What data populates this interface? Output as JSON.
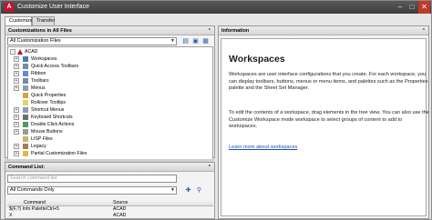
{
  "window": {
    "title": "Customize User Interface",
    "icon": "autocad-icon"
  },
  "tabs": [
    {
      "label": "Customize"
    },
    {
      "label": "Transfer"
    }
  ],
  "customizations": {
    "header": "Customizations in All Files",
    "filter": "All Customization Files",
    "tree": [
      {
        "label": "ACAD",
        "icon": "acad-icon",
        "expander": "-"
      },
      {
        "label": "Workspaces",
        "icon": "workspace-icon",
        "expander": "+"
      },
      {
        "label": "Quick Access Toolbars",
        "icon": "toolbar-icon",
        "expander": "+"
      },
      {
        "label": "Ribbon",
        "icon": "ribbon-icon",
        "expander": "+"
      },
      {
        "label": "Toolbars",
        "icon": "toolbar-icon",
        "expander": "+"
      },
      {
        "label": "Menus",
        "icon": "menu-icon",
        "expander": "+"
      },
      {
        "label": "Quick Properties",
        "icon": "properties-icon",
        "expander": ""
      },
      {
        "label": "Rollover Tooltips",
        "icon": "tooltip-icon",
        "expander": ""
      },
      {
        "label": "Shortcut Menus",
        "icon": "menu-icon",
        "expander": "+"
      },
      {
        "label": "Keyboard Shortcuts",
        "icon": "keyboard-icon",
        "expander": "+"
      },
      {
        "label": "Double Click Actions",
        "icon": "click-icon",
        "expander": "+"
      },
      {
        "label": "Mouse Buttons",
        "icon": "mouse-icon",
        "expander": "+"
      },
      {
        "label": "LISP Files",
        "icon": "lisp-icon",
        "expander": ""
      },
      {
        "label": "Legacy",
        "icon": "legacy-icon",
        "expander": "+"
      },
      {
        "label": "Partial Customization Files",
        "icon": "folder-icon",
        "expander": "+"
      }
    ]
  },
  "command_list": {
    "header": "Command List:",
    "search_placeholder": "Search command list",
    "filter": "All Commands Only",
    "columns": [
      "Command",
      "Source"
    ],
    "rows": [
      {
        "command": "$(F,?) Info PaletteCtrl+5",
        "source": "ACAD"
      },
      {
        "command": "X",
        "source": "ACAD"
      }
    ]
  },
  "information": {
    "header": "Information",
    "title": "Workspaces",
    "para1": "Workspaces are user interface configurations that you create. For each workspace, you can display toolbars, buttons, menus or menu items, and palettes such as the Properties palette and the Sheet Set Manager.",
    "para2": "To edit the contents of a workspace, drag elements in the tree view. You can also use the Customize Workspace mode workspace to select groups of content to add to workspaces.",
    "link": "Learn more about workspaces"
  },
  "colors": {
    "accent": "#c8102e",
    "link": "#1a4fb4"
  }
}
